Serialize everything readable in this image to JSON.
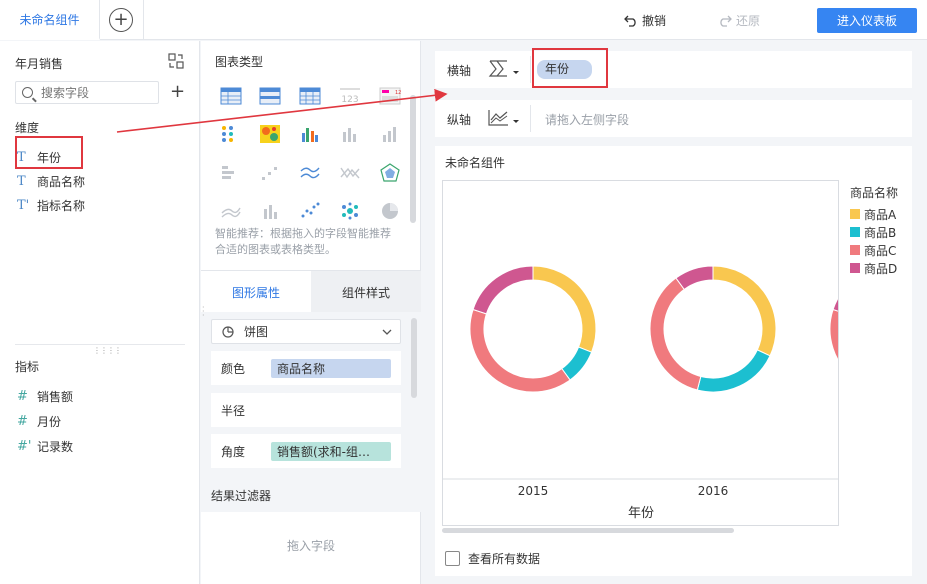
{
  "topbar": {
    "tab_label": "未命名组件",
    "undo_label": "撤销",
    "redo_label": "还原",
    "enter_label": "进入仪表板"
  },
  "fields_panel": {
    "dataset_title": "年月销售",
    "search_placeholder": "搜索字段",
    "dimension_label": "维度",
    "dimensions": [
      "年份",
      "商品名称",
      "指标名称"
    ],
    "measure_label": "指标",
    "measures": [
      "销售额",
      "月份",
      "记录数"
    ]
  },
  "types_panel": {
    "title": "图表类型",
    "hint": "智能推荐：根据拖入的字段智能推荐合适的图表或表格类型。",
    "tab_props": "图形属性",
    "tab_style": "组件样式",
    "chart_select": "饼图",
    "color_label": "颜色",
    "color_value": "商品名称",
    "radius_label": "半径",
    "angle_label": "角度",
    "angle_value": "销售额(求和-组…",
    "filter_title": "结果过滤器",
    "filter_drop": "拖入字段"
  },
  "axes": {
    "x_label": "横轴",
    "x_value": "年份",
    "y_label": "纵轴",
    "y_placeholder": "请拖入左侧字段"
  },
  "chart": {
    "card_title": "未命名组件",
    "show_all_label": "查看所有数据"
  },
  "colors": {
    "A": "#f9c74f",
    "B": "#1cbfd0",
    "C": "#f07a7e",
    "D": "#cf5790",
    "accent": "#3685f2",
    "highlight": "#e0373f"
  },
  "chart_data": {
    "type": "pie",
    "subtype": "donut",
    "categories": [
      "2015",
      "2016"
    ],
    "xlabel": "年份",
    "legend_title": "商品名称",
    "legend_position": "right",
    "series": [
      {
        "name": "商品A",
        "values": [
          0.31,
          0.32
        ]
      },
      {
        "name": "商品B",
        "values": [
          0.09,
          0.22
        ]
      },
      {
        "name": "商品C",
        "values": [
          0.4,
          0.36
        ]
      },
      {
        "name": "商品D",
        "values": [
          0.2,
          0.1
        ]
      }
    ]
  }
}
